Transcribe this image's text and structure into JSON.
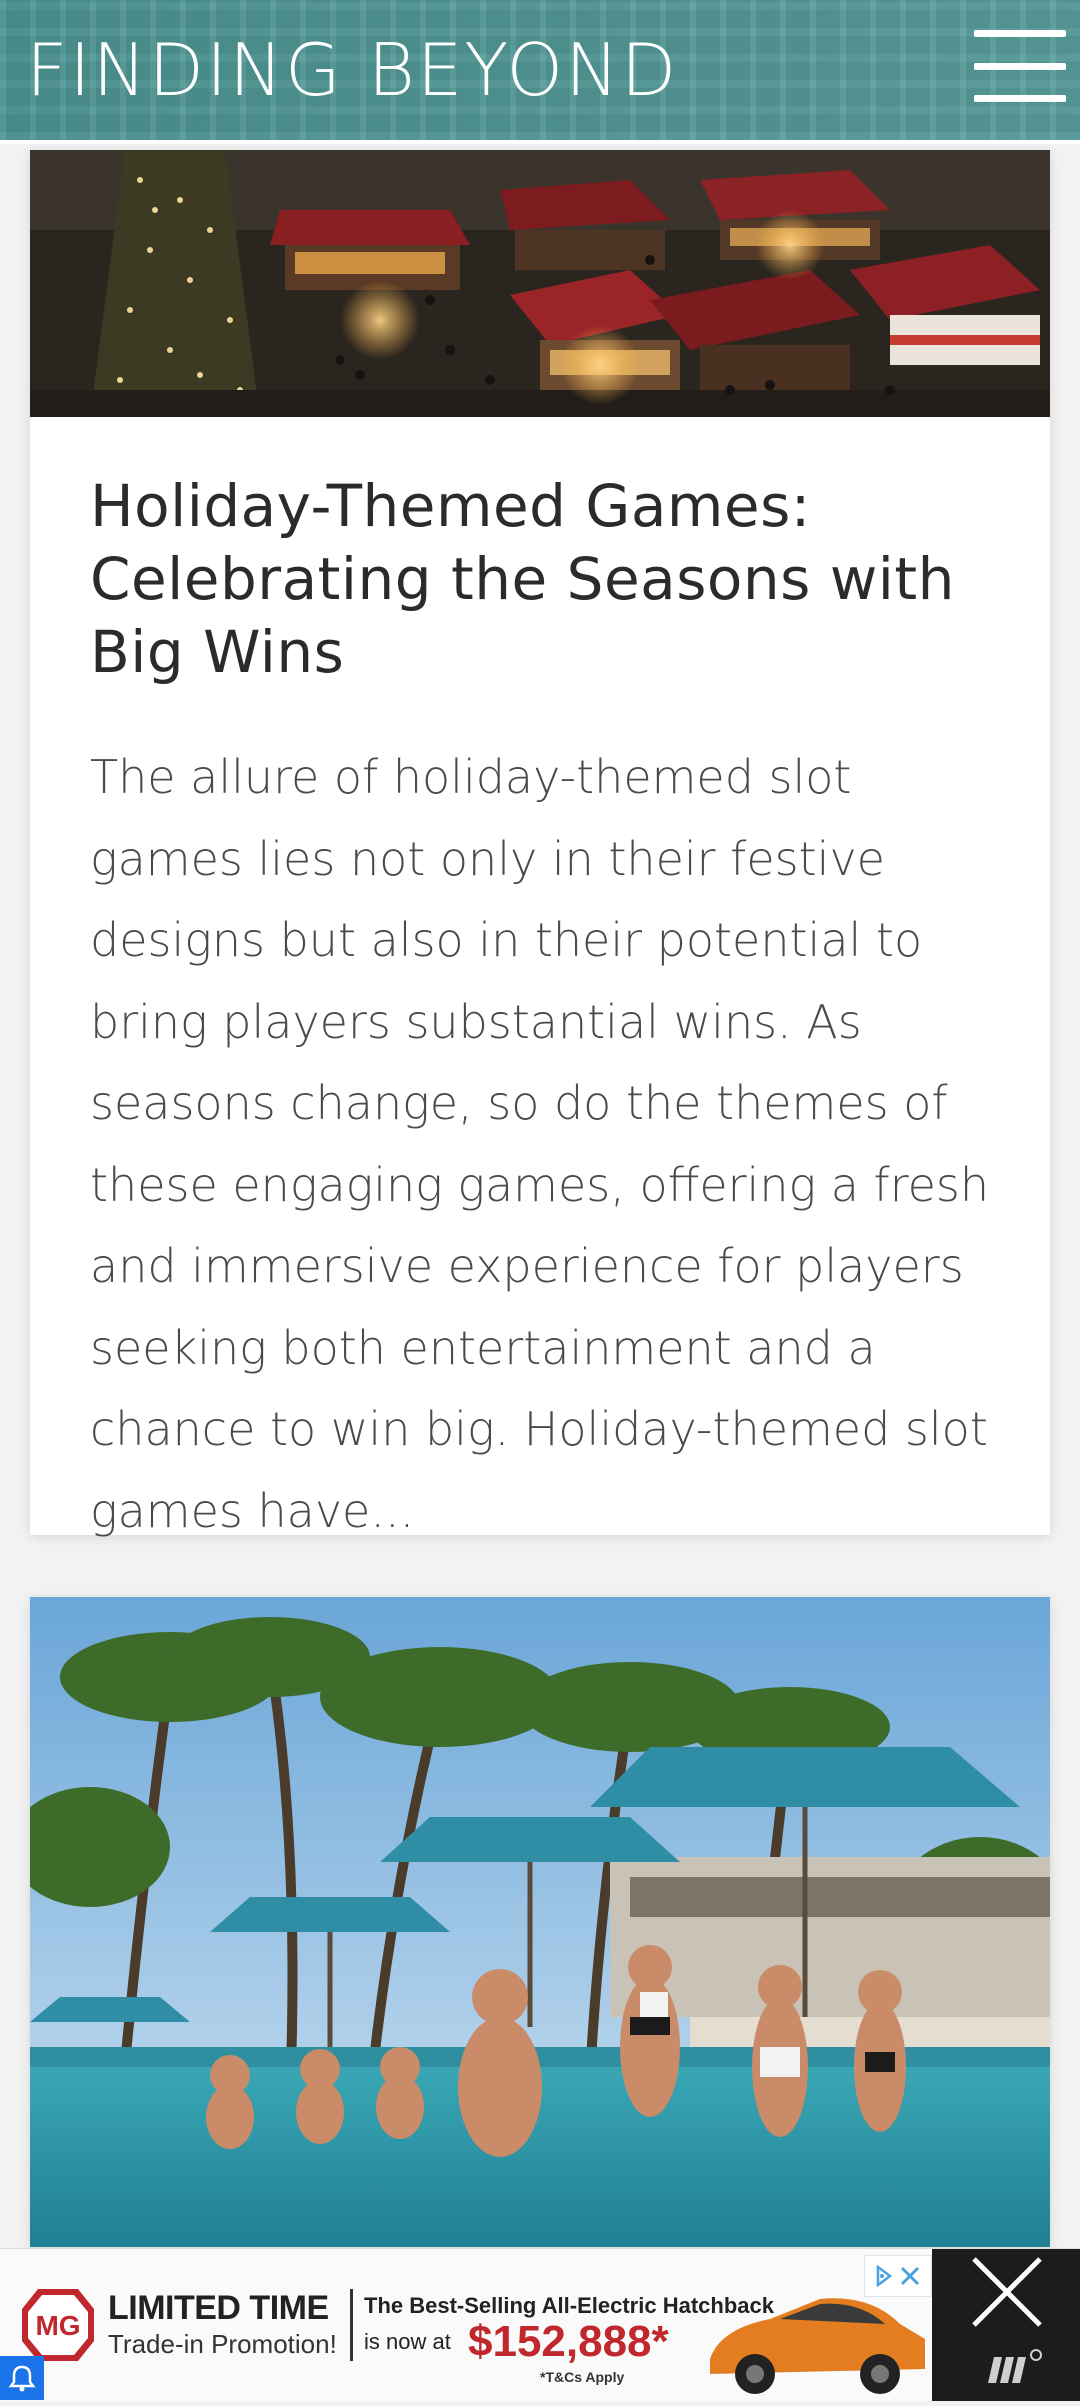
{
  "header": {
    "logo": "FINDING BEYOND",
    "menu_icon": "hamburger-menu-icon"
  },
  "posts": [
    {
      "title": "Holiday-Themed Games: Celebrating the Seasons with Big Wins",
      "excerpt": "The allure of holiday-themed slot games lies not only in their festive designs but also in their potential to bring players substantial wins. As seasons change, so do the themes of these engaging games, offering a fresh and immersive experience for players seeking both entertainment and a chance to win big. Holiday-themed slot games have..."
    }
  ],
  "ad": {
    "brand": "MG",
    "headline": "LIMITED TIME",
    "subheadline": "Trade-in Promotion!",
    "text1": "The Best-Selling All-Electric Hatchback",
    "text2": "is now at",
    "price": "$152,888*",
    "terms": "*T&Cs Apply"
  }
}
